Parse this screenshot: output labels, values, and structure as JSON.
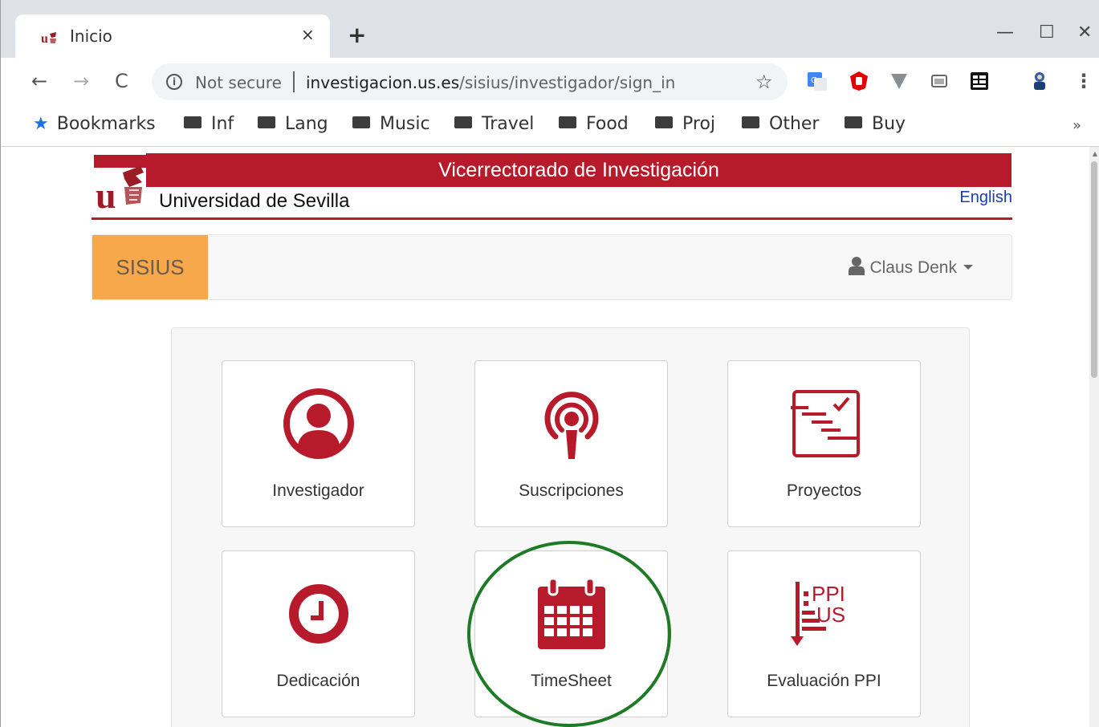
{
  "browser": {
    "tab_title": "Inicio",
    "tab_close": "×",
    "new_tab": "+",
    "window_buttons": {
      "minimize": "—",
      "maximize": "☐",
      "close": "✕"
    },
    "nav": {
      "back": "←",
      "forward": "→",
      "reload": "C"
    },
    "security_label": "Not secure",
    "url_host": "investigacion.us.es",
    "url_path": "/sisius/investigador/sign_in",
    "bookmark_star": "☆",
    "bookmarks_label": "Bookmarks",
    "bookmark_folders": [
      "Inf",
      "Lang",
      "Music",
      "Travel",
      "Food",
      "Proj",
      "Other",
      "Buy"
    ],
    "bookmarks_more": "»"
  },
  "header": {
    "banner": "Vicerrectorado de Investigación",
    "university": "Universidad de Sevilla",
    "language_link": "English"
  },
  "navbar": {
    "brand": "SISIUS",
    "user": "Claus Denk"
  },
  "modules": [
    {
      "label": "Investigador",
      "icon": "user-circle-icon"
    },
    {
      "label": "Suscripciones",
      "icon": "podcast-icon"
    },
    {
      "label": "Proyectos",
      "icon": "gantt-tasks-icon"
    },
    {
      "label": "Dedicación",
      "icon": "clock-icon"
    },
    {
      "label": "TimeSheet",
      "icon": "calendar-icon"
    },
    {
      "label": "Evaluación PPI",
      "icon": "ppi-us-icon"
    }
  ],
  "colors": {
    "brand_red": "#b71b2b",
    "brand_orange": "#f7a84b",
    "highlight_green": "#1f7a25"
  }
}
